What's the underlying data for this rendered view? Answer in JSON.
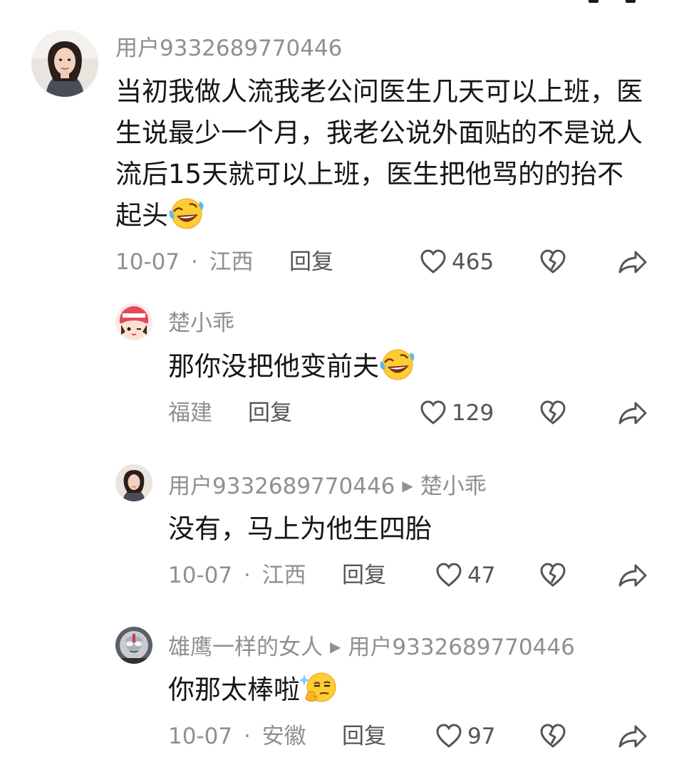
{
  "comments": [
    {
      "username": "用户9332689770446",
      "text": "当初我做人流我老公问医生几天可以上班，医生说最少一个月，我老公说外面贴的不是说人流后15天就可以上班，医生把他骂的的抬不起头",
      "emoji": "rofl-emoji",
      "date": "10-07",
      "sep": "·",
      "location": "江西",
      "reply_label": "回复",
      "likes": "465"
    },
    {
      "username": "楚小乖",
      "text": "那你没把他变前夫",
      "emoji": "rofl-emoji",
      "date": "",
      "sep": "",
      "location": "福建",
      "reply_label": "回复",
      "likes": "129"
    },
    {
      "username": "用户9332689770446",
      "reply_to": "楚小乖",
      "text": "没有，马上为他生四胎",
      "date": "10-07",
      "sep": "·",
      "location": "江西",
      "reply_label": "回复",
      "likes": "47"
    },
    {
      "username": "雄鹰一样的女人",
      "reply_to": "用户9332689770446",
      "text": "你那太棒啦",
      "emoji": "smug-emoji",
      "date": "10-07",
      "sep": "·",
      "location": "安徽",
      "reply_label": "回复",
      "likes": "97"
    }
  ],
  "icons": {
    "like": "heart-outline-icon",
    "dislike": "broken-heart-icon",
    "share": "share-arrow-icon",
    "reply_arrow": "triangle-right-icon"
  },
  "colors": {
    "text": "#161616",
    "muted": "#8f8f94",
    "action": "#555557"
  }
}
